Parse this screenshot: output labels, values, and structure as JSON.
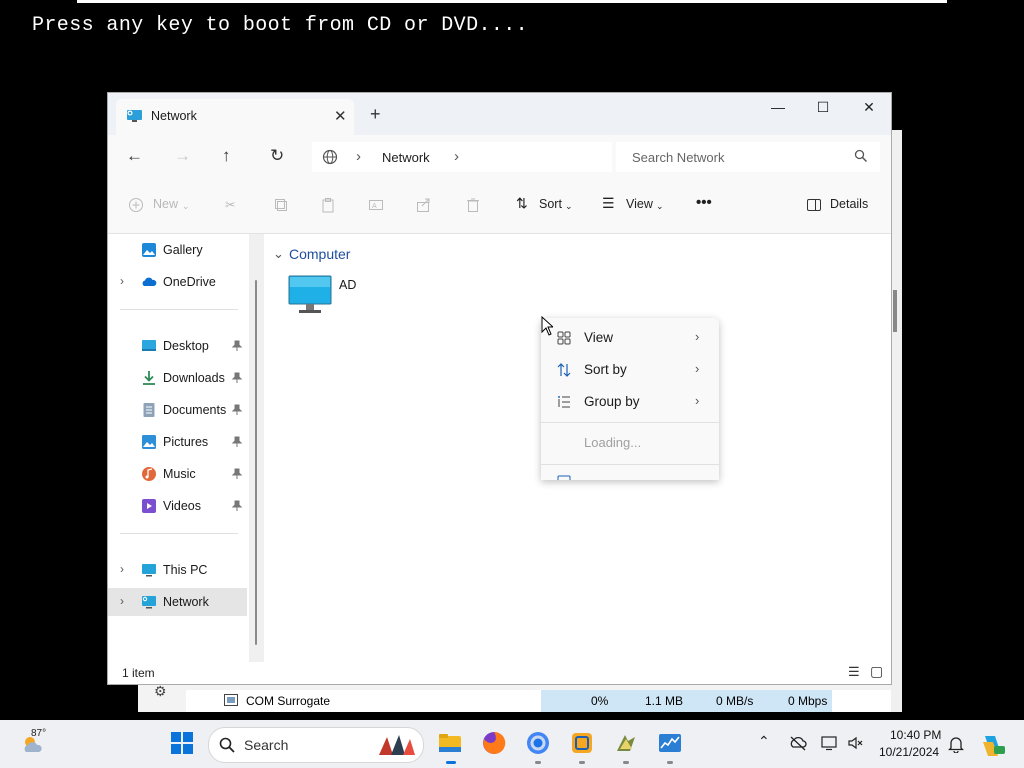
{
  "boot_message": "Press any key to boot from CD or DVD....",
  "background_window": {
    "process_name": "COM Surrogate",
    "cpu": "0%",
    "memory": "1.1 MB",
    "disk": "0 MB/s",
    "network": "0 Mbps"
  },
  "explorer": {
    "tab_title": "Network",
    "new_tab": "+",
    "address_segment": "Network",
    "search_placeholder": "Search Network",
    "toolbar": {
      "new": "New",
      "sort": "Sort",
      "view": "View",
      "more": "•••",
      "details": "Details"
    },
    "sidebar": {
      "items": [
        {
          "label": "Gallery"
        },
        {
          "label": "OneDrive"
        },
        {
          "label": "Desktop"
        },
        {
          "label": "Downloads"
        },
        {
          "label": "Documents"
        },
        {
          "label": "Pictures"
        },
        {
          "label": "Music"
        },
        {
          "label": "Videos"
        },
        {
          "label": "This PC"
        },
        {
          "label": "Network"
        }
      ]
    },
    "group_header": "Computer",
    "items": [
      {
        "label": "AD",
        "icon": "monitor-icon"
      }
    ],
    "status_text": "1 item"
  },
  "context_menu": {
    "items": [
      {
        "label": "View",
        "icon": "grid-icon"
      },
      {
        "label": "Sort by",
        "icon": "sort-icon"
      },
      {
        "label": "Group by",
        "icon": "list-icon"
      }
    ],
    "loading": "Loading..."
  },
  "taskbar": {
    "weather_temp": "87°",
    "search_label": "Search",
    "time": "10:40 PM",
    "date": "10/21/2024"
  },
  "colors": {
    "accent": "#0067c0",
    "group_header": "#1f4e9e",
    "selection": "#e5e5e5"
  }
}
